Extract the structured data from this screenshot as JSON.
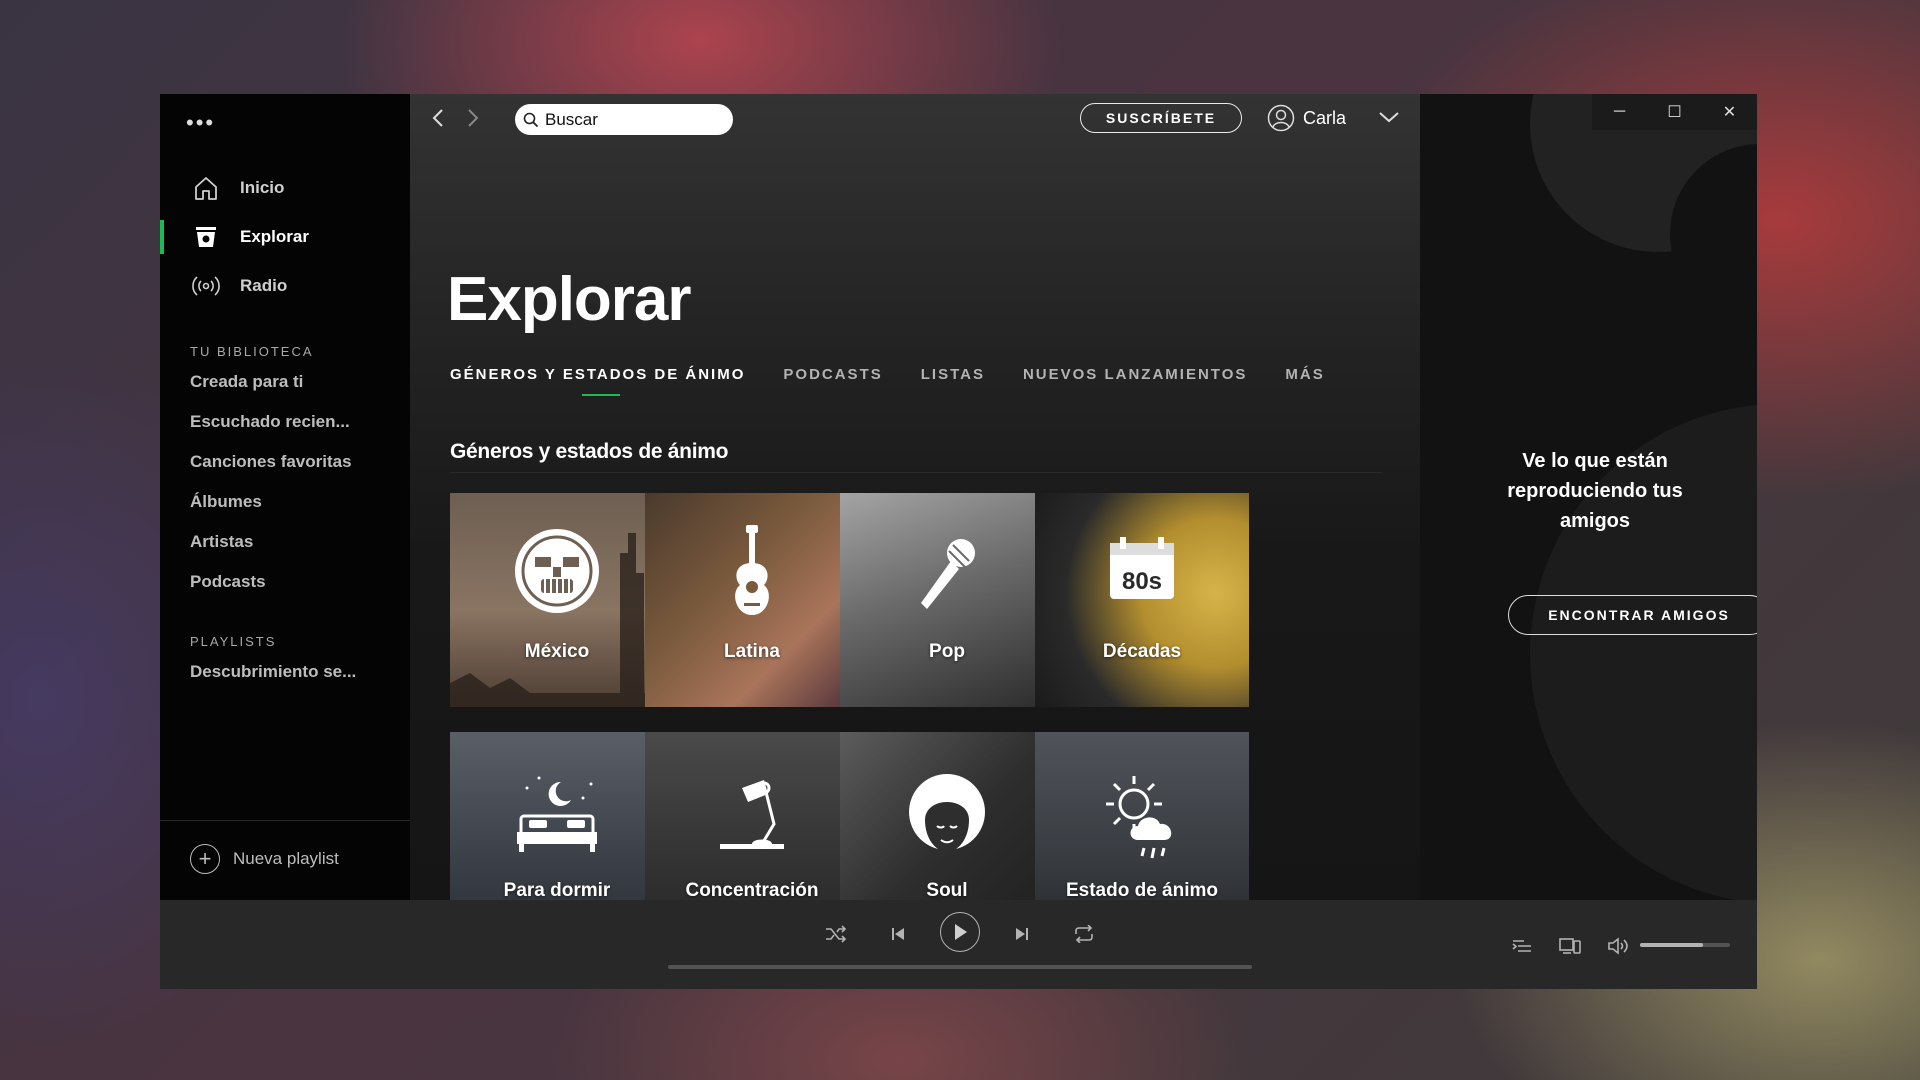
{
  "window": {
    "controls": {
      "minimize": "─",
      "maximize": "☐",
      "close": "✕"
    }
  },
  "sidebar": {
    "menu_dots": "•••",
    "nav": [
      {
        "label": "Inicio",
        "icon": "home-icon"
      },
      {
        "label": "Explorar",
        "icon": "browse-icon",
        "active": true
      },
      {
        "label": "Radio",
        "icon": "radio-icon"
      }
    ],
    "library_heading": "TU BIBLIOTECA",
    "library": [
      "Creada para ti",
      "Escuchado recien...",
      "Canciones favoritas",
      "Álbumes",
      "Artistas",
      "Podcasts"
    ],
    "playlists_heading": "PLAYLISTS",
    "playlists": [
      "Descubrimiento se..."
    ],
    "new_playlist": "Nueva playlist"
  },
  "header": {
    "search_placeholder": "Buscar",
    "subscribe": "SUSCRÍBETE",
    "user_name": "Carla"
  },
  "main": {
    "title": "Explorar",
    "tabs": [
      {
        "label": "GÉNEROS Y ESTADOS DE ÁNIMO",
        "active": true
      },
      {
        "label": "PODCASTS"
      },
      {
        "label": "LISTAS"
      },
      {
        "label": "NUEVOS LANZAMIENTOS"
      },
      {
        "label": "MÁS"
      }
    ],
    "section_title": "Géneros y estados de ánimo",
    "tiles": [
      {
        "label": "México",
        "icon": "aztec-mask-icon"
      },
      {
        "label": "Latina",
        "icon": "guitar-icon"
      },
      {
        "label": "Pop",
        "icon": "microphone-icon"
      },
      {
        "label": "Décadas",
        "icon": "calendar-80s-icon",
        "icon_text": "80s"
      },
      {
        "label": "Para dormir",
        "icon": "bed-moon-icon"
      },
      {
        "label": "Concentración",
        "icon": "desk-lamp-icon"
      },
      {
        "label": "Soul",
        "icon": "afro-face-icon"
      },
      {
        "label": "Estado de ánimo",
        "icon": "sun-cloud-rain-icon"
      }
    ]
  },
  "friends": {
    "text": "Ve lo que están reproduciendo tus amigos",
    "button": "ENCONTRAR AMIGOS"
  },
  "player": {
    "volume": 0.7,
    "progress": 0
  },
  "colors": {
    "accent": "#1db954",
    "sidebar_bg": "#040404",
    "player_bg": "#282828"
  }
}
